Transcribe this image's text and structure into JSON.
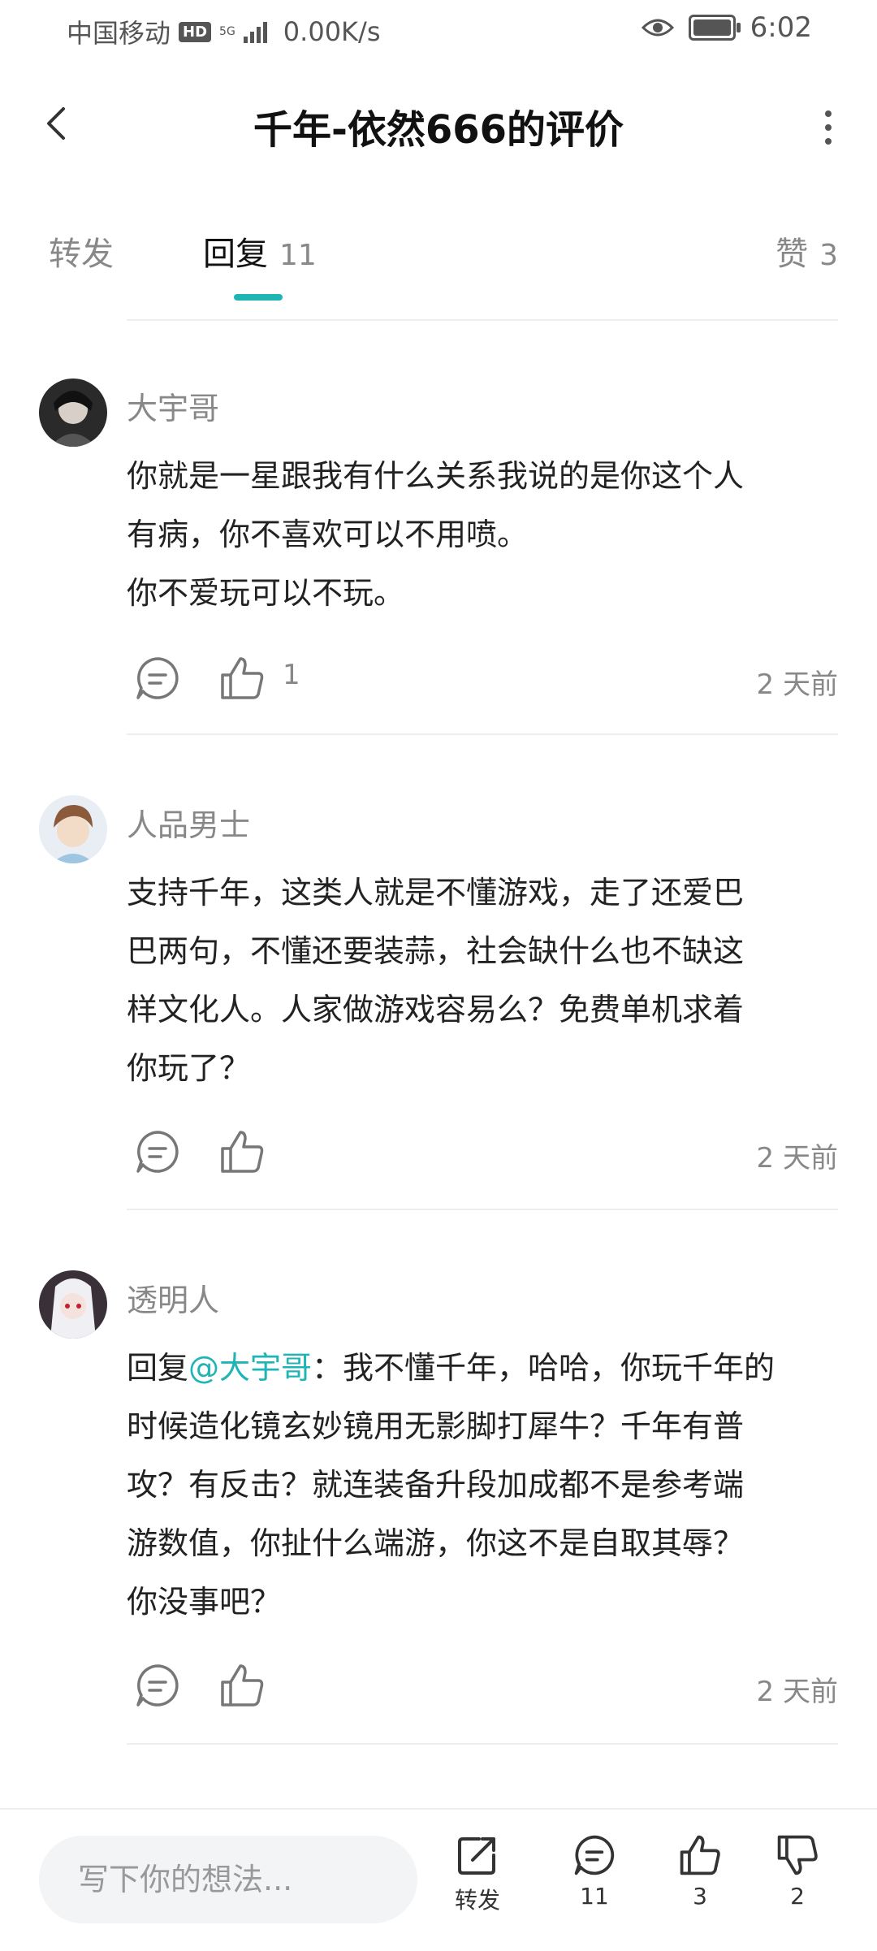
{
  "status_bar": {
    "carrier": "中国移动",
    "hd": "HD",
    "network": "5G",
    "speed": "0.00K/s",
    "time": "6:02"
  },
  "header": {
    "title": "千年-依然666的评价",
    "back_icon": "chevron-left-icon",
    "more_icon": "more-vertical-icon"
  },
  "tabs": [
    {
      "label": "转发",
      "count": ""
    },
    {
      "label": "回复",
      "count": "11",
      "active": true
    },
    {
      "label": "赞",
      "count": "3"
    }
  ],
  "accent_color": "#1fb5b5",
  "comments": [
    {
      "author": "大宇哥",
      "lines": [
        "你就是一星跟我有什么关系我说的是你这个人",
        "有病，你不喜欢可以不用喷。",
        "你不爱玩可以不玩。"
      ],
      "likes": "1",
      "time": "2 天前"
    },
    {
      "author": "人品男士",
      "lines": [
        "支持千年，这类人就是不懂游戏，走了还爱巴",
        "巴两句，不懂还要装蒜，社会缺什么也不缺这",
        "样文化人。人家做游戏容易么？免费单机求着",
        "你玩了？"
      ],
      "likes": "",
      "time": "2 天前"
    },
    {
      "author": "透明人",
      "reply_prefix": "回复",
      "mention": "@大宇哥",
      "first_line_rest": "：我不懂千年，哈哈，你玩千年的",
      "lines": [
        "时候造化镜玄妙镜用无影脚打犀牛？千年有普",
        "攻？有反击？就连装备升段加成都不是参考端",
        "游数值，你扯什么端游，你这不是自取其辱？",
        "你没事吧？"
      ],
      "likes": "",
      "time": "2 天前"
    }
  ],
  "bottom_bar": {
    "input_placeholder": "写下你的想法...",
    "share_label": "转发",
    "comment_count": "11",
    "like_count": "3",
    "dislike_count": "2"
  }
}
